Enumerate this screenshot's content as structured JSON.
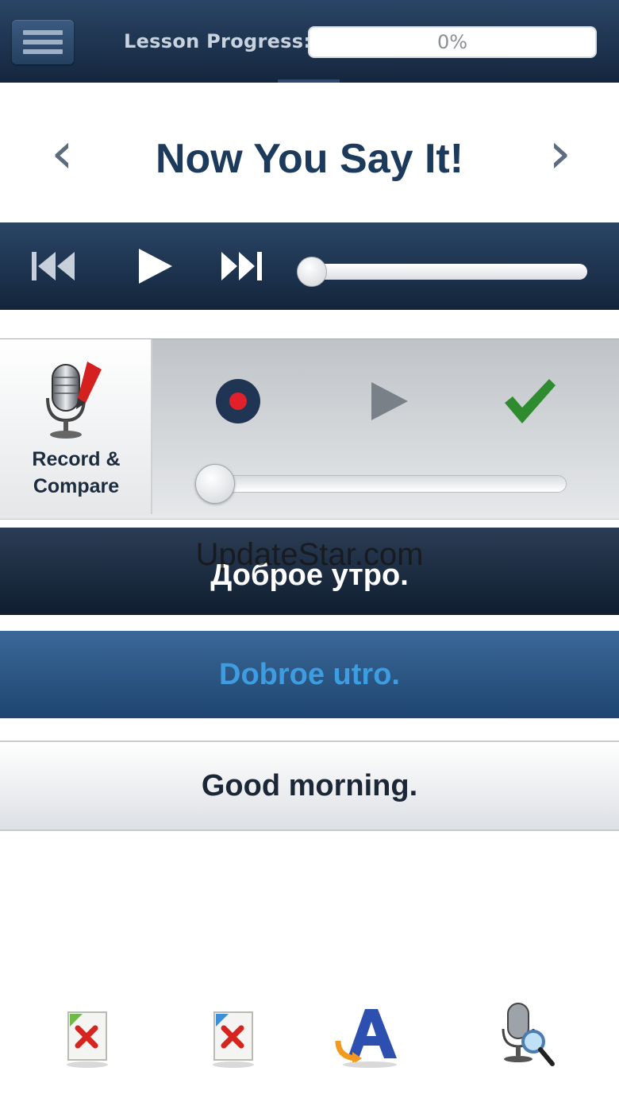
{
  "header": {
    "progress_label": "Lesson Progress:",
    "progress_text": "0%",
    "progress_value": 0
  },
  "title": {
    "text": "Now You Say It!",
    "prev_icon": "chevron-left-icon",
    "next_icon": "chevron-right-icon"
  },
  "player": {
    "position": 0
  },
  "record": {
    "label_line1": "Record &",
    "label_line2": "Compare",
    "position": 0
  },
  "phrase": {
    "native": "Доброе утро.",
    "transliteration": "Dobroe utro.",
    "english": "Good morning."
  },
  "watermark": "UpdateStar.com",
  "colors": {
    "header": "#1c3350",
    "accent_blue": "#3d9de0",
    "record_red": "#e0202a",
    "check_green": "#2e8b2e"
  }
}
